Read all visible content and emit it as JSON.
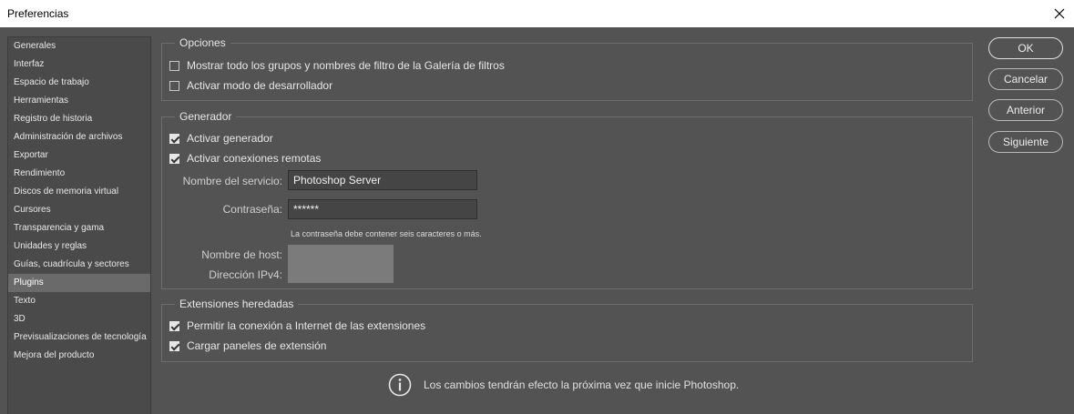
{
  "window": {
    "title": "Preferencias"
  },
  "sidebar": {
    "items": [
      "Generales",
      "Interfaz",
      "Espacio de trabajo",
      "Herramientas",
      "Registro de historia",
      "Administración de archivos",
      "Exportar",
      "Rendimiento",
      "Discos de memoria virtual",
      "Cursores",
      "Transparencia y gama",
      "Unidades y reglas",
      "Guías, cuadrícula y sectores",
      "Plugins",
      "Texto",
      "3D",
      "Previsualizaciones de tecnología",
      "Mejora del producto"
    ],
    "selected": "Plugins"
  },
  "options": {
    "legend": "Opciones",
    "show_filter_gallery": {
      "label": "Mostrar todo los grupos y nombres de filtro de la Galería de filtros",
      "checked": false
    },
    "developer_mode": {
      "label": "Activar modo de desarrollador",
      "checked": false
    }
  },
  "generator": {
    "legend": "Generador",
    "enable_generator": {
      "label": "Activar generador",
      "checked": true
    },
    "remote_connections": {
      "label": "Activar conexiones remotas",
      "checked": true
    },
    "service_name_label": "Nombre del servicio:",
    "service_name_value": "Photoshop Server",
    "password_label": "Contraseña:",
    "password_value": "******",
    "password_hint": "La contraseña debe contener seis caracteres o más.",
    "host_label": "Nombre de host:",
    "ipv4_label": "Dirección IPv4:"
  },
  "legacy": {
    "legend": "Extensiones heredadas",
    "allow_internet": {
      "label": "Permitir la conexión a Internet de las extensiones",
      "checked": true
    },
    "load_panels": {
      "label": "Cargar paneles de extensión",
      "checked": true
    }
  },
  "buttons": {
    "ok": "OK",
    "cancel": "Cancelar",
    "previous": "Anterior",
    "next": "Siguiente"
  },
  "info": {
    "icon": "info-icon",
    "text": "Los cambios tendrán efecto la próxima vez que inicie Photoshop."
  }
}
